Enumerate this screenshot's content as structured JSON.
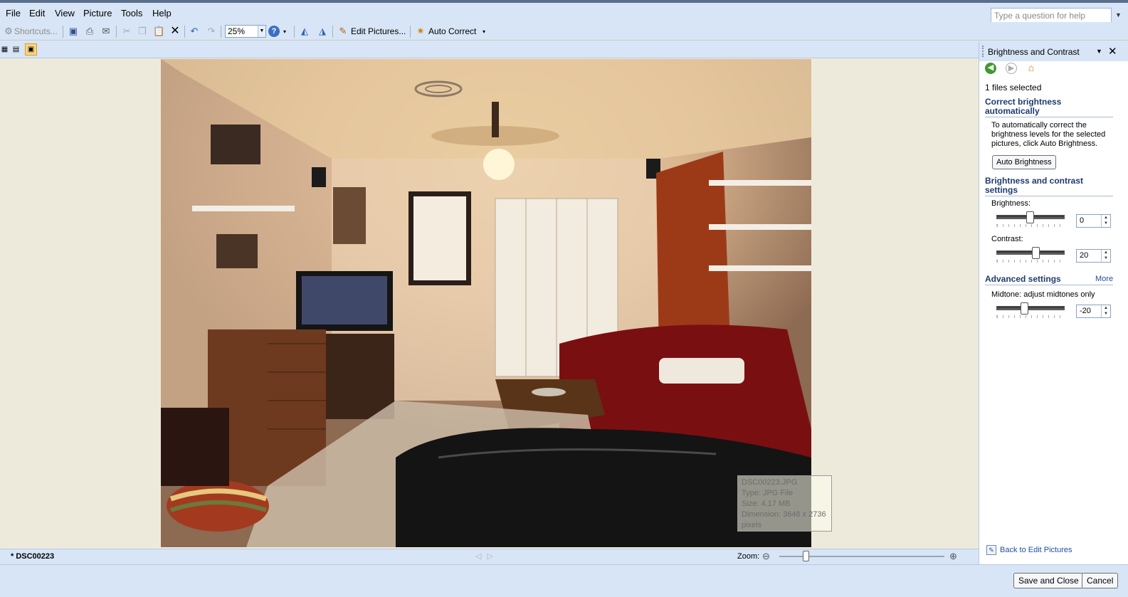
{
  "menu": {
    "file": "File",
    "edit": "Edit",
    "view": "View",
    "picture": "Picture",
    "tools": "Tools",
    "help": "Help",
    "help_placeholder": "Type a question for help"
  },
  "toolbar": {
    "shortcuts_label": "Shortcuts...",
    "zoom_value": "25%",
    "edit_pictures_label": "Edit Pictures...",
    "auto_correct_label": "Auto Correct"
  },
  "image": {
    "tooltip": {
      "name": "DSC00223.JPG",
      "type": "Type: JPG File",
      "size": "Size: 4.17 MB",
      "dimension_line1": "Dimension: 3648 x 2736",
      "dimension_line2": "pixels"
    }
  },
  "status": {
    "file_name": "* DSC00223",
    "zoom_label": "Zoom:",
    "zoom_slider_fraction": 0.16
  },
  "bottom": {
    "save_close": "Save and Close",
    "cancel": "Cancel"
  },
  "taskpane": {
    "title": "Brightness and Contrast",
    "files_selected": "1 files selected",
    "auto_section_title": "Correct brightness automatically",
    "auto_description": "To automatically correct the brightness levels for the selected pictures, click Auto Brightness.",
    "auto_button": "Auto Brightness",
    "settings_section_title": "Brightness and contrast settings",
    "brightness_label": "Brightness:",
    "brightness_value": "0",
    "contrast_label": "Contrast:",
    "contrast_value": "20",
    "advanced_title": "Advanced settings",
    "more_link": "More",
    "midtone_label": "Midtone: adjust midtones only",
    "midtone_value": "-20",
    "back_link": "Back to Edit Pictures"
  }
}
